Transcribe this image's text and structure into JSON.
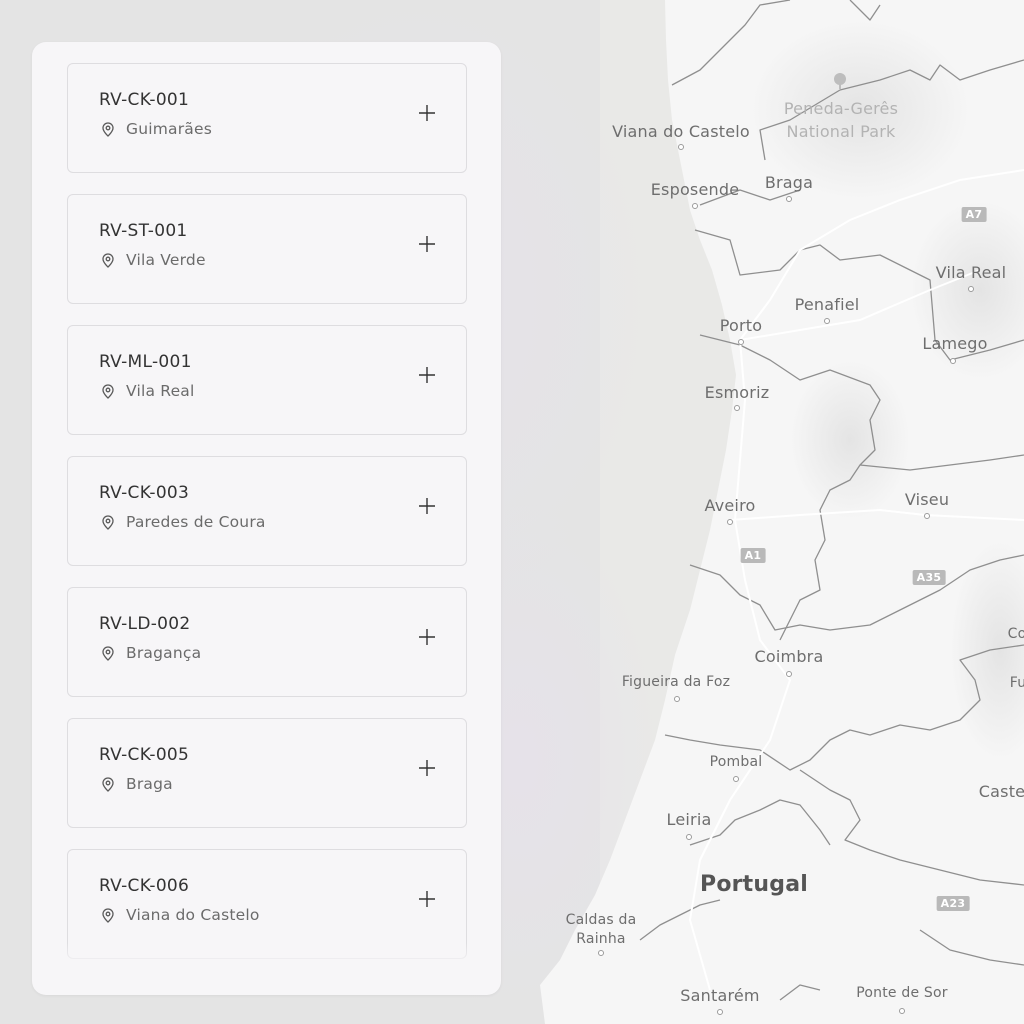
{
  "locations": [
    {
      "id": "RV-CK-001",
      "place": "Guimarães"
    },
    {
      "id": "RV-ST-001",
      "place": "Vila Verde"
    },
    {
      "id": "RV-ML-001",
      "place": "Vila Real"
    },
    {
      "id": "RV-CK-003",
      "place": "Paredes de Coura"
    },
    {
      "id": "RV-LD-002",
      "place": "Bragança"
    },
    {
      "id": "RV-CK-005",
      "place": "Braga"
    },
    {
      "id": "RV-CK-006",
      "place": "Viana do Castelo"
    }
  ],
  "icons": {
    "location": "map-pin-icon",
    "add": "plus-icon"
  },
  "map": {
    "country": "Portugal",
    "park": "Peneda-Gerês National Park",
    "park_line1": "Peneda-Gerês",
    "park_line2": "National Park",
    "cities": {
      "viana_do_castelo": "Viana do Castelo",
      "esposende": "Esposende",
      "braga": "Braga",
      "vila_real": "Vila Real",
      "penafiel": "Penafiel",
      "porto": "Porto",
      "lamego": "Lamego",
      "esmoriz": "Esmoriz",
      "aveiro": "Aveiro",
      "viseu": "Viseu",
      "coimbra": "Coimbra",
      "figueira_da_foz": "Figueira da Foz",
      "pombal": "Pombal",
      "leiria": "Leiria",
      "caldas_line1": "Caldas da",
      "caldas_line2": "Rainha",
      "santarem": "Santarém",
      "ponte_de_sor": "Ponte de Sor",
      "caste_partial": "Caste",
      "co_partial": "Co",
      "fu_partial": "Fu"
    },
    "roads": {
      "a7": "A7",
      "a1": "A1",
      "a35": "A35",
      "a23": "A23"
    },
    "colors": {
      "land": "#f6f6f6",
      "water": "#e8e8e6",
      "boundary": "#8f8f8f"
    }
  }
}
